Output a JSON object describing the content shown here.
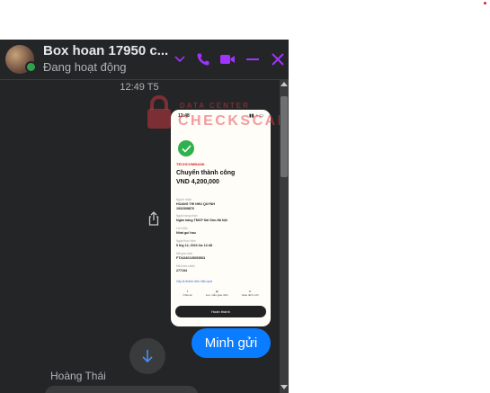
{
  "header": {
    "title": "Box hoan 17950 c...",
    "status": "Đang hoạt động",
    "accent_color": "#a033ff",
    "icons": [
      "chevron-down-icon",
      "phone-icon",
      "video-icon",
      "minimize-icon",
      "close-icon"
    ]
  },
  "conversation": {
    "timestamp": "12:49 T5",
    "message_out": "Minh gửi",
    "sender_name": "Hoàng Thái"
  },
  "watermark": {
    "small": "DATA CENTER",
    "big": "CHECKSCAM.VN"
  },
  "receipt": {
    "time": "12:48",
    "bank_name": "TECHCOMBANK",
    "title": "Chuyển thành công",
    "amount": "VND 4,200,000",
    "fields": [
      {
        "label": "Người nhận",
        "value": "HOANG THI NHU QUYNH"
      },
      {
        "label": "",
        "value": "1932308876"
      },
      {
        "label": "Ngân hàng nhận",
        "value": "Ngân hàng TMCP Sài Gòn-Hà Nội"
      },
      {
        "label": "Lời nhắn",
        "value": "Nhat gui hau"
      },
      {
        "label": "Ngày thực hiện",
        "value": "5 thg 12, 2024 lúc 12:48"
      },
      {
        "label": "Mã giao dịch",
        "value": "FT24340115653563"
      },
      {
        "label": "Mã tham chiếu",
        "value": "277194"
      }
    ],
    "link": "Xây là thành viên hiệu quả",
    "actions": [
      "Chia sẻ",
      "Lưu mẫu giao dịch",
      "Giao dịch mới"
    ],
    "done_button": "Hoàn thành"
  }
}
